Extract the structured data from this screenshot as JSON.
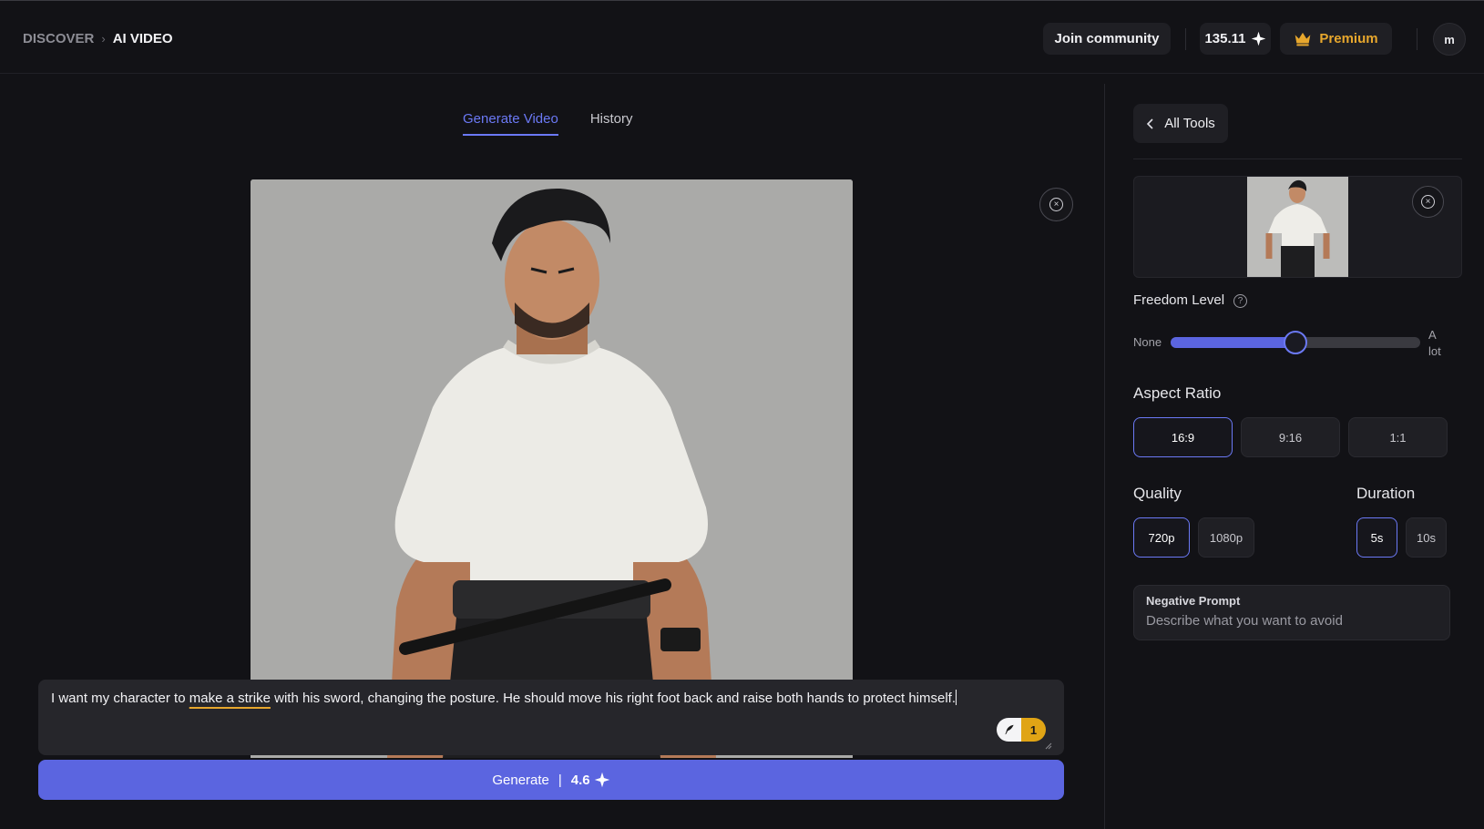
{
  "breadcrumb": {
    "root": "DISCOVER",
    "separator": "›",
    "current": "AI VIDEO"
  },
  "header": {
    "community_label": "Join community",
    "credits": "135.11",
    "premium_label": "Premium",
    "avatar_initial": "m"
  },
  "tabs": [
    {
      "label": "Generate Video",
      "active": true
    },
    {
      "label": "History",
      "active": false
    }
  ],
  "prompt": {
    "before": "I want my character to ",
    "highlight": "make a strike",
    "after": " with his sword, changing the posture. He should move his right foot back and raise both hands to protect himself.",
    "badge_count": "1"
  },
  "generate": {
    "label": "Generate",
    "separator": "|",
    "cost": "4.6"
  },
  "panel": {
    "back_label": "All Tools",
    "freedom": {
      "label": "Freedom Level",
      "help": "?",
      "min_label": "None",
      "max_label_1": "A",
      "max_label_2": "lot",
      "value": 0.5
    },
    "aspect": {
      "label": "Aspect Ratio",
      "options": [
        "16:9",
        "9:16",
        "1:1"
      ],
      "selected": "16:9"
    },
    "quality": {
      "label": "Quality",
      "options": [
        "720p",
        "1080p"
      ],
      "selected": "720p"
    },
    "duration": {
      "label": "Duration",
      "options": [
        "5s",
        "10s"
      ],
      "selected": "5s"
    },
    "negative": {
      "title": "Negative Prompt",
      "placeholder": "Describe what you want to avoid"
    }
  },
  "colors": {
    "accent": "#5b65e0",
    "accent_light": "#6b79f5",
    "premium": "#e7a72d",
    "background": "#121216"
  },
  "icons": {
    "remove": "close-circle-icon",
    "credits": "sparkle-icon",
    "premium": "crown-icon",
    "back": "chevron-left-icon",
    "enhance": "feather-icon"
  }
}
